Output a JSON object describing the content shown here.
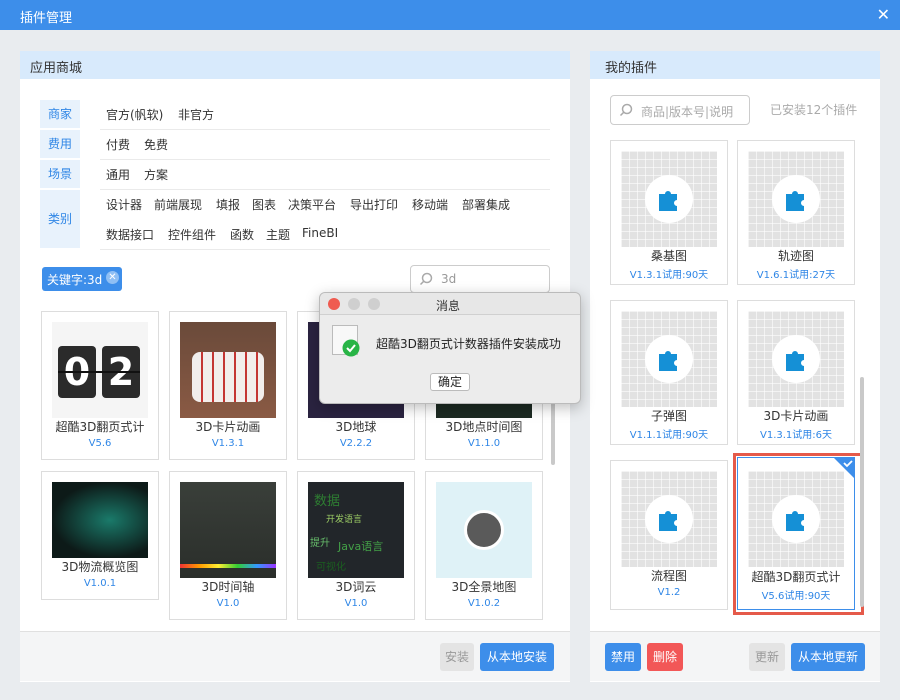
{
  "window": {
    "title": "插件管理",
    "close_icon": "close-icon"
  },
  "store": {
    "title": "应用商城",
    "filters": [
      {
        "label": "商家",
        "options": [
          "官方(帆软)",
          "非官方"
        ]
      },
      {
        "label": "费用",
        "options": [
          "付费",
          "免费"
        ]
      },
      {
        "label": "场景",
        "options": [
          "通用",
          "方案"
        ]
      },
      {
        "label": "类别",
        "options": [
          "设计器",
          "前端展现",
          "填报",
          "图表",
          "决策平台",
          "导出打印",
          "移动端",
          "部署集成",
          "数据接口",
          "控件组件",
          "函数",
          "主题",
          "FineBI"
        ]
      }
    ],
    "keyword_chip": "关键字:3d",
    "search_value": "3d",
    "cards": [
      {
        "name": "超酷3D翻页式计",
        "version": "V5.6"
      },
      {
        "name": "3D卡片动画",
        "version": "V1.3.1"
      },
      {
        "name": "3D地球",
        "version": "V2.2.2"
      },
      {
        "name": "3D地点时间图",
        "version": "V1.1.0"
      },
      {
        "name": "3D物流概览图",
        "version": "V1.0.1"
      },
      {
        "name": "3D时间轴",
        "version": "V1.0"
      },
      {
        "name": "3D词云",
        "version": "V1.0"
      },
      {
        "name": "3D全景地图",
        "version": "V1.0.2"
      }
    ],
    "flip_digits": [
      "0",
      "2"
    ],
    "wordcloud_words": [
      "开发语言",
      "提升",
      "Java语言",
      "数据",
      "可视化"
    ],
    "install_label": "安装",
    "install_local_label": "从本地安装"
  },
  "mine": {
    "title": "我的插件",
    "search_placeholder": "商品|版本号|说明",
    "installed_count": "已安装12个插件",
    "cards": [
      {
        "name": "桑基图",
        "version": "V1.3.1试用:90天"
      },
      {
        "name": "轨迹图",
        "version": "V1.6.1试用:27天"
      },
      {
        "name": "子弹图",
        "version": "V1.1.1试用:90天"
      },
      {
        "name": "3D卡片动画",
        "version": "V1.3.1试用:6天"
      },
      {
        "name": "流程图",
        "version": "V1.2"
      },
      {
        "name": "超酷3D翻页式计",
        "version": "V5.6试用:90天"
      }
    ],
    "disable_label": "禁用",
    "delete_label": "删除",
    "update_label": "更新",
    "update_local_label": "从本地更新"
  },
  "dialog": {
    "title": "消息",
    "message": "超酷3D翻页式计数器插件安装成功",
    "ok_label": "确定"
  },
  "colors": {
    "accent": "#3d8eea",
    "danger": "#f25757",
    "success": "#28b446",
    "selection": "#e55a4a"
  }
}
